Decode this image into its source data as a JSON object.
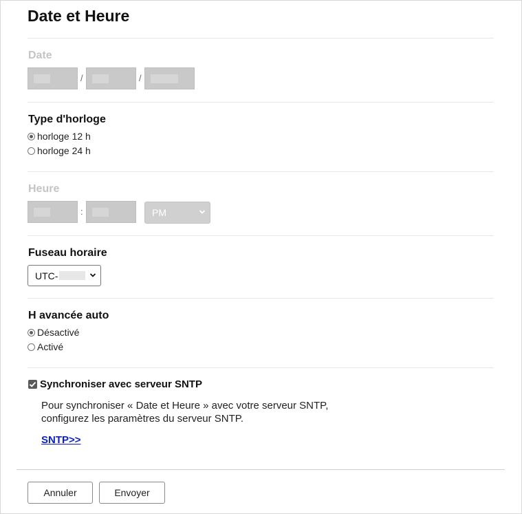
{
  "page": {
    "title": "Date et Heure"
  },
  "date": {
    "label": "Date",
    "separator": "/"
  },
  "clock_type": {
    "label": "Type d'horloge",
    "options": [
      "horloge 12 h",
      "horloge 24 h"
    ],
    "selected": "horloge 12 h"
  },
  "time": {
    "label": "Heure",
    "separator": ":",
    "ampm": "PM"
  },
  "timezone": {
    "label": "Fuseau horaire",
    "value": "UTC-"
  },
  "dst": {
    "label": "H avancée auto",
    "options": [
      "Désactivé",
      "Activé"
    ],
    "selected": "Désactivé"
  },
  "sntp": {
    "checkbox_label": "Synchroniser avec serveur SNTP",
    "checked": true,
    "description_line1": "Pour synchroniser « Date et Heure » avec votre serveur SNTP,",
    "description_line2": "configurez les paramètres du serveur SNTP.",
    "link": "SNTP>>"
  },
  "footer": {
    "cancel": "Annuler",
    "submit": "Envoyer"
  },
  "colors": {
    "link": "#0b1fc7",
    "disabled_label": "#c4c4c4"
  }
}
